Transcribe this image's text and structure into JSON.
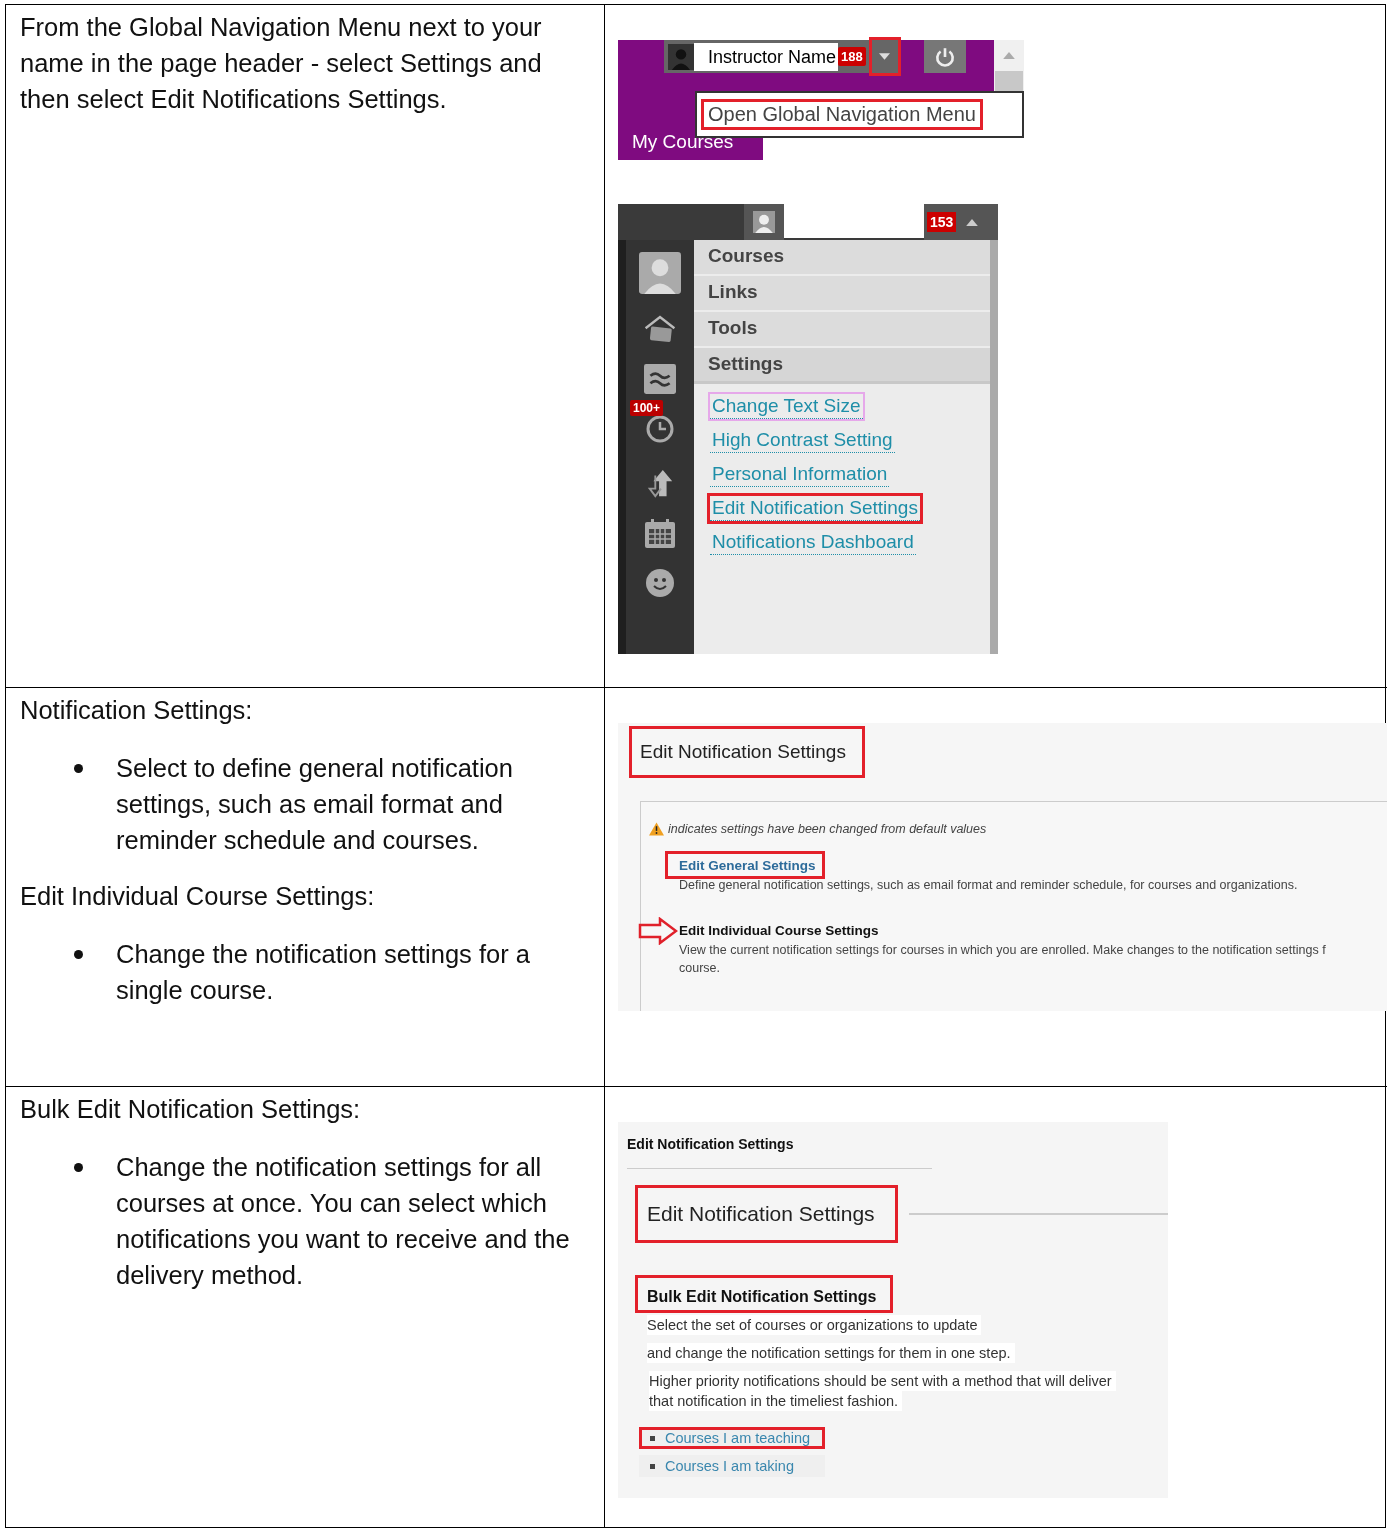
{
  "rows": [
    {
      "instructions": [
        {
          "kind": "text",
          "text": "From the Global Navigation Menu next to your name in the page header - select Settings and then select Edit Notifications Settings."
        }
      ],
      "screenshots": [
        {
          "kind": "header_bar",
          "user_name": "Instructor Name",
          "notification_count": "188",
          "menu_button_highlighted": true,
          "tooltip": {
            "text": "Open Global Navigation Menu",
            "highlighted": true
          },
          "tab": "My Courses"
        },
        {
          "kind": "global_menu",
          "notification_count": "153",
          "sidebar_badge": "100+",
          "menu_items": [
            {
              "text": "Courses",
              "selected": false
            },
            {
              "text": "Links",
              "selected": false
            },
            {
              "text": "Tools",
              "selected": false
            },
            {
              "text": "Settings",
              "selected": true
            }
          ],
          "links": [
            {
              "text": "Change Text Size",
              "focused": true,
              "highlighted": false
            },
            {
              "text": "High Contrast Setting",
              "focused": false,
              "highlighted": false
            },
            {
              "text": "Personal Information",
              "focused": false,
              "highlighted": false
            },
            {
              "text": "Edit Notification Settings",
              "focused": false,
              "highlighted": true
            },
            {
              "text": "Notifications Dashboard",
              "focused": false,
              "highlighted": false
            }
          ]
        }
      ]
    },
    {
      "instructions": [
        {
          "kind": "text",
          "text": "Notification Settings:"
        },
        {
          "kind": "bullet",
          "text": "Select to define general notification settings, such as email format and reminder schedule and courses."
        },
        {
          "kind": "text",
          "text": "Edit Individual Course Settings:"
        },
        {
          "kind": "bullet",
          "text": "Change the notification settings for a single course."
        }
      ],
      "screenshots": [
        {
          "kind": "notification_page",
          "title": {
            "text": "Edit Notification Settings",
            "highlighted": true
          },
          "legend": "indicates settings have been changed from default values",
          "sections": [
            {
              "title": "Edit General Settings",
              "link": true,
              "highlighted": true,
              "arrow": false,
              "lines": [
                "Define general notification settings, such as email format and reminder schedule, for courses and organizations."
              ]
            },
            {
              "title": "Edit Individual Course Settings",
              "link": false,
              "highlighted": false,
              "arrow": true,
              "lines": [
                "View the current notification settings for courses in which you are enrolled. Make changes to the notification settings f",
                "course."
              ]
            }
          ]
        }
      ]
    },
    {
      "instructions": [
        {
          "kind": "text",
          "text": "Bulk Edit Notification Settings:"
        },
        {
          "kind": "bullet",
          "text": "Change the notification settings for all courses at once. You can select which notifications you want to receive and the delivery method."
        }
      ],
      "screenshots": [
        {
          "kind": "bulk_edit",
          "breadcrumb": "Edit Notification Settings",
          "title": {
            "text": "Edit Notification Settings",
            "highlighted": true
          },
          "section": {
            "text": "Bulk Edit Notification Settings",
            "highlighted": true
          },
          "lines": [
            "Select the set of courses or organizations to update",
            "and change the notification settings for them in one step.",
            "Higher priority  notifications should be sent with a method that will deliver",
            "that notification in the timeliest fashion."
          ],
          "links": [
            {
              "text": "Courses I am teaching",
              "highlighted": true
            },
            {
              "text": "Courses I am taking",
              "highlighted": false
            }
          ]
        }
      ]
    }
  ]
}
